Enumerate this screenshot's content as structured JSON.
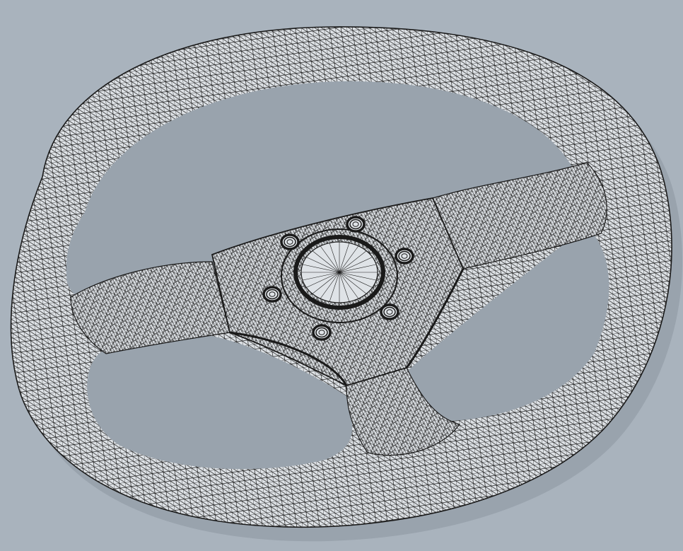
{
  "viewport": {
    "subject": "steering-wheel-wireframe",
    "render_mode": "wireframe",
    "background_color": "#a9b3bd",
    "mesh_fill_color": "#dfe3e7",
    "mesh_line_color": "#1a1a1a",
    "shadow_color": "#8c96a0",
    "bolt_count": 6
  }
}
